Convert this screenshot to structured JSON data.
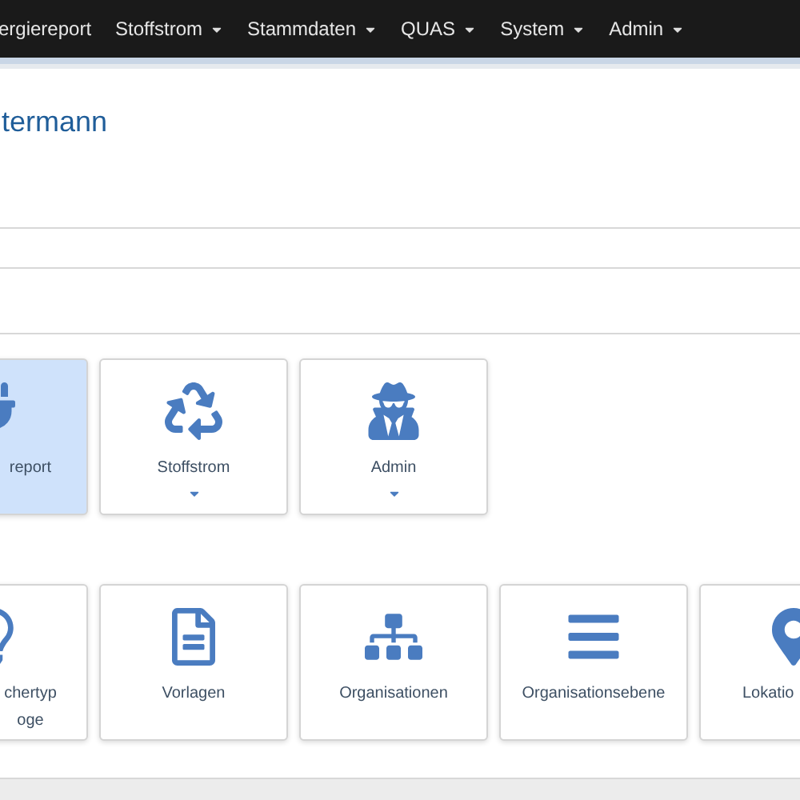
{
  "navbar": {
    "items": [
      {
        "label": "ergiereport",
        "dropdown": false
      },
      {
        "label": "Stoffstrom",
        "dropdown": true
      },
      {
        "label": "Stammdaten",
        "dropdown": true
      },
      {
        "label": "QUAS",
        "dropdown": true
      },
      {
        "label": "System",
        "dropdown": true
      },
      {
        "label": "Admin",
        "dropdown": true
      }
    ]
  },
  "title": "termann",
  "tile_rows": [
    {
      "tiles": [
        {
          "label": "report",
          "selected": true,
          "dropdown": false
        },
        {
          "label": "Stoffstrom",
          "selected": false,
          "dropdown": true
        },
        {
          "label": "Admin",
          "selected": false,
          "dropdown": true
        }
      ]
    },
    {
      "tiles": [
        {
          "label": "chertyp oge",
          "selected": false,
          "dropdown": false
        },
        {
          "label": "Vorlagen",
          "selected": false,
          "dropdown": false
        },
        {
          "label": "Organisationen",
          "selected": false,
          "dropdown": false
        },
        {
          "label": "Organisationsebene",
          "selected": false,
          "dropdown": false
        },
        {
          "label": "Lokatio",
          "selected": false,
          "dropdown": false
        }
      ]
    }
  ]
}
